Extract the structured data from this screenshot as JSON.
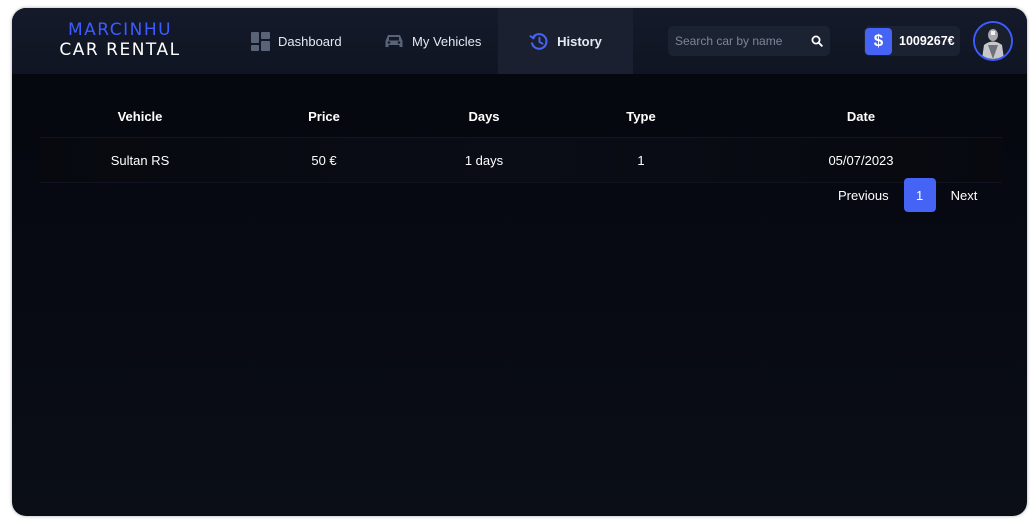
{
  "brand": {
    "top": "MARCINHU",
    "bottom": "CAR RENTAL"
  },
  "nav": {
    "items": [
      {
        "label": "Dashboard",
        "icon": "dashboard-icon"
      },
      {
        "label": "My Vehicles",
        "icon": "car-icon"
      },
      {
        "label": "History",
        "icon": "history-icon",
        "active": true
      }
    ]
  },
  "search": {
    "placeholder": "Search car by name",
    "value": ""
  },
  "balance": {
    "currency_symbol": "$",
    "value": "1009267€"
  },
  "colors": {
    "accent": "#4563f5",
    "brand_blue": "#3d5cff",
    "background": "#070a13",
    "header": "#141a2a"
  },
  "table": {
    "headers": [
      "Vehicle",
      "Price",
      "Days",
      "Type",
      "Date"
    ],
    "rows": [
      [
        "Sultan RS",
        "50 €",
        "1 days",
        "1",
        "05/07/2023"
      ]
    ]
  },
  "pagination": {
    "previous": "Previous",
    "current_page": "1",
    "next": "Next"
  }
}
